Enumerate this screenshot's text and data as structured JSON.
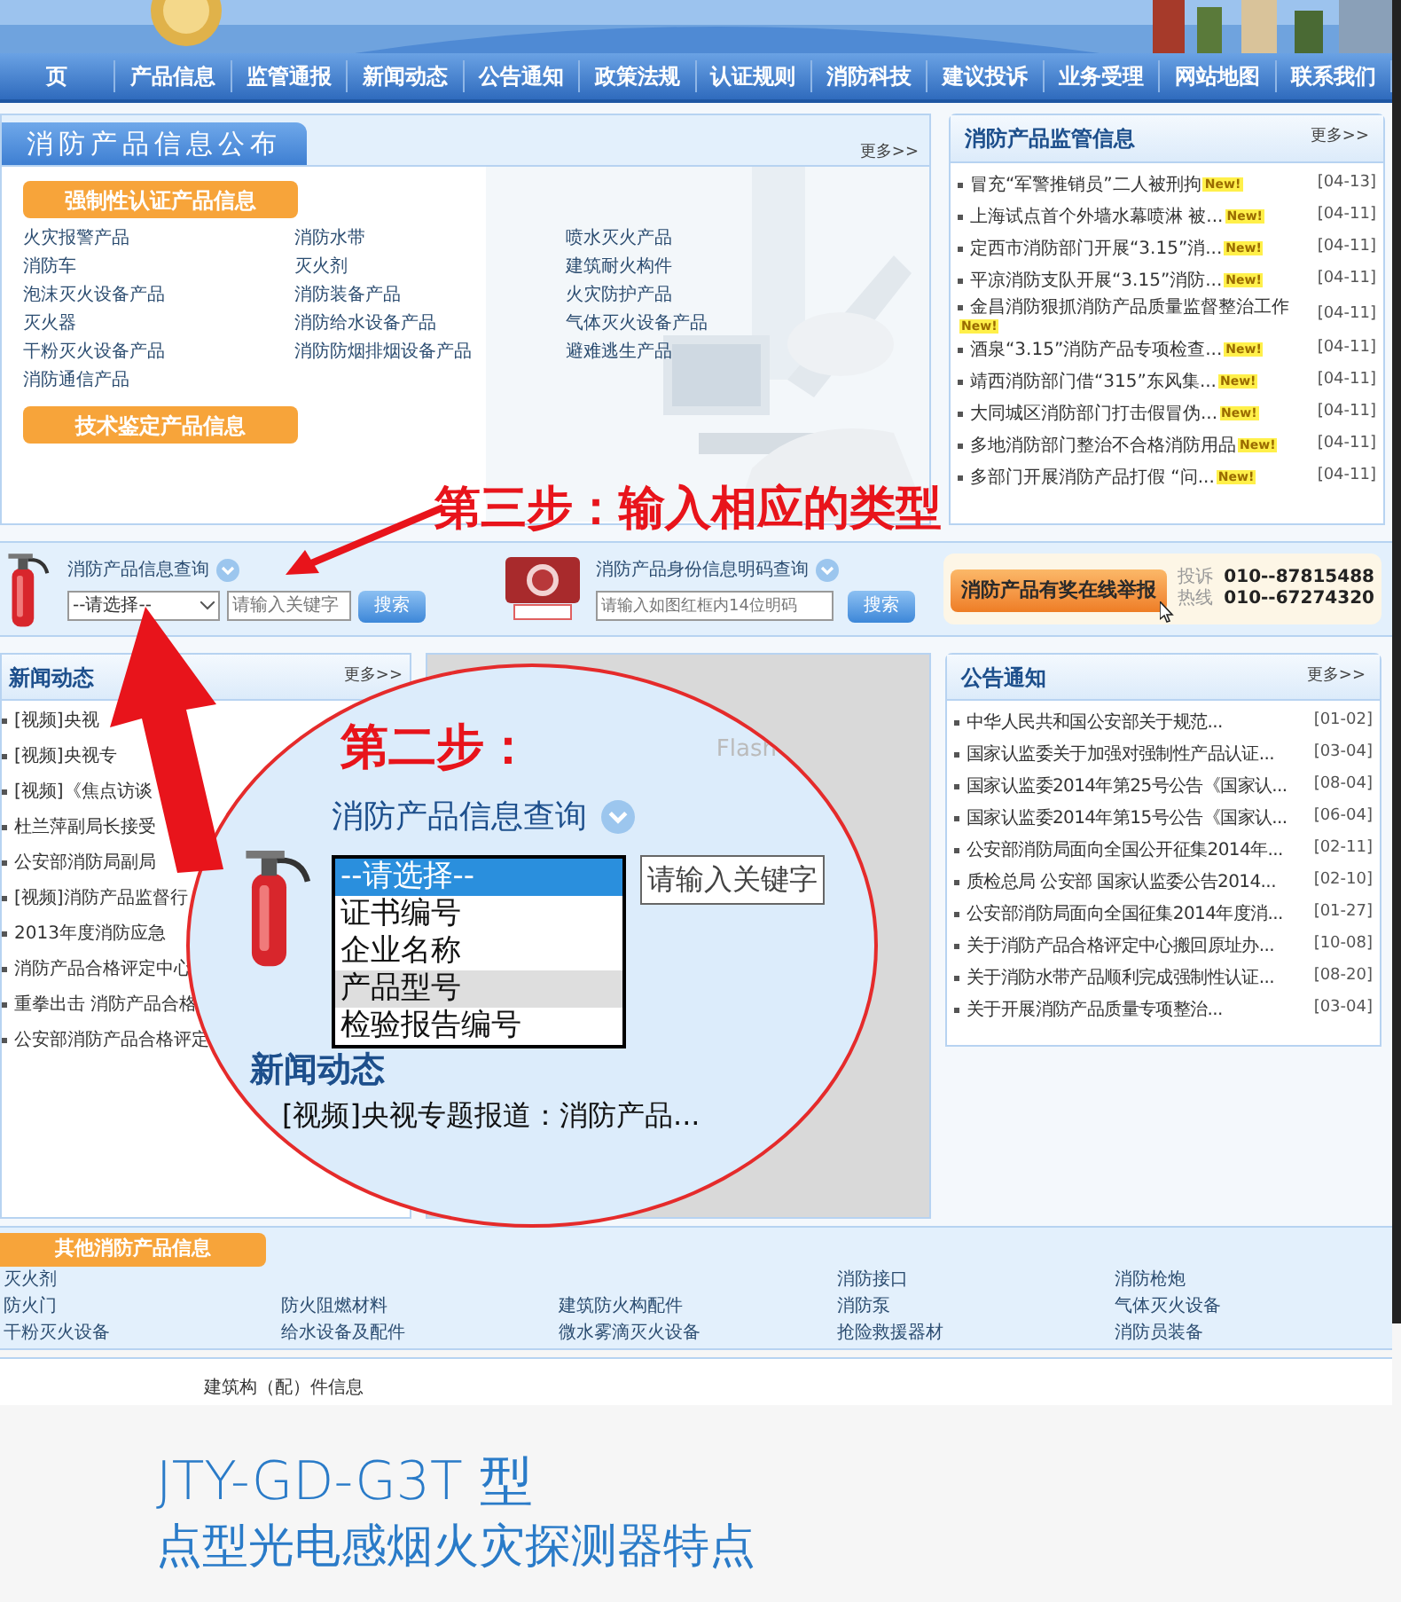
{
  "nav": [
    "页",
    "产品信息",
    "监管通报",
    "新闻动态",
    "公告通知",
    "政策法规",
    "认证规则",
    "消防科技",
    "建议投诉",
    "业务受理",
    "网站地图",
    "联系我们"
  ],
  "product_info": {
    "title": "消防产品信息公布",
    "more": "更多>>",
    "sections": [
      {
        "label": "强制性认证产品信息",
        "items": [
          "火灾报警产品",
          "消防水带",
          "喷水灭火产品",
          "消防车",
          "灭火剂",
          "建筑耐火构件",
          "泡沫灭火设备产品",
          "消防装备产品",
          "火灾防护产品",
          "灭火器",
          "消防给水设备产品",
          "气体灭火设备产品",
          "干粉灭火设备产品",
          "消防防烟排烟设备产品",
          "避难逃生产品",
          "消防通信产品"
        ]
      },
      {
        "label": "技术鉴定产品信息"
      }
    ]
  },
  "supervision": {
    "title": "消防产品监管信息",
    "more": "更多>>",
    "items": [
      {
        "text": "冒充“军警推销员”二人被刑拘",
        "badge": "New!",
        "date": "[04-13]"
      },
      {
        "text": "上海试点首个外墙水幕喷淋 被...",
        "badge": "New!",
        "date": "[04-11]"
      },
      {
        "text": "定西市消防部门开展“3.15”消...",
        "badge": "New!",
        "date": "[04-11]"
      },
      {
        "text": "平凉消防支队开展“3.15”消防...",
        "badge": "New!",
        "date": "[04-11]"
      },
      {
        "text": "金昌消防狠抓消防产品质量监督整治工作",
        "badge": "New!",
        "date": "[04-11]"
      },
      {
        "text": "酒泉“3.15”消防产品专项检查...",
        "badge": "New!",
        "date": "[04-11]"
      },
      {
        "text": "靖西消防部门借“315”东风集...",
        "badge": "New!",
        "date": "[04-11]"
      },
      {
        "text": "大同城区消防部门打击假冒伪...",
        "badge": "New!",
        "date": "[04-11]"
      },
      {
        "text": "多地消防部门整治不合格消防用品",
        "badge": "New!",
        "date": "[04-11]"
      },
      {
        "text": "多部门开展消防产品打假 “问...",
        "badge": "New!",
        "date": "[04-11]"
      }
    ]
  },
  "annotations": {
    "step3": "第三步：输入相应的类型"
  },
  "search": {
    "query": {
      "title": "消防产品信息查询",
      "select": "--请选择--",
      "placeholder": "请输入关键字",
      "button": "搜索"
    },
    "code_query": {
      "title": "消防产品身份信息明码查询",
      "placeholder": "请输入如图红框内14位明码",
      "button": "搜索"
    },
    "report": {
      "button": "消防产品有奖在线举报",
      "labels": [
        "投诉",
        "热线"
      ],
      "phones": [
        "010--87815488",
        "010--67274320"
      ]
    }
  },
  "news": {
    "title": "新闻动态",
    "more": "更多>>",
    "items": [
      "[视频]央视",
      "[视频]央视专",
      "[视频]《焦点访谈",
      "杜兰萍副局长接受",
      "公安部消防局副局",
      "[视频]消防产品监督行",
      "2013年度消防应急",
      "消防产品合格评定中心",
      "重拳出击 消防产品合格",
      "公安部消防产品合格评定"
    ]
  },
  "notices": {
    "title": "公告通知",
    "more": "更多>>",
    "items": [
      {
        "text": "中华人民共和国公安部关于规范...",
        "date": "[01-02]"
      },
      {
        "text": "国家认监委关于加强对强制性产品认证...",
        "date": "[03-04]"
      },
      {
        "text": "国家认监委2014年第25号公告《国家认...",
        "date": "[08-04]"
      },
      {
        "text": "国家认监委2014年第15号公告《国家认...",
        "date": "[06-04]"
      },
      {
        "text": "公安部消防局面向全国公开征集2014年...",
        "date": "[02-11]"
      },
      {
        "text": "质检总局 公安部 国家认监委公告2014...",
        "date": "[02-10]"
      },
      {
        "text": "公安部消防局面向全国征集2014年度消...",
        "date": "[01-27]"
      },
      {
        "text": "关于消防产品合格评定中心搬回原址办...",
        "date": "[10-08]"
      },
      {
        "text": "关于消防水带产品顺利完成强制性认证...",
        "date": "[08-20]"
      },
      {
        "text": "关于开展消防产品质量专项整治...",
        "date": "[03-04]"
      }
    ]
  },
  "magnifier": {
    "step": "第二步：",
    "flash": "Flash",
    "title": "消防产品信息查询",
    "options": [
      {
        "label": "--请选择--",
        "selected": true,
        "highlighted": false
      },
      {
        "label": "证书编号",
        "selected": false,
        "highlighted": false
      },
      {
        "label": "企业名称",
        "selected": false,
        "highlighted": false
      },
      {
        "label": "产品型号",
        "selected": false,
        "highlighted": true
      },
      {
        "label": "检验报告编号",
        "selected": false,
        "highlighted": false
      }
    ],
    "placeholder": "请输入关键字",
    "news_title": "新闻动态",
    "news_item": "[视频]央视专题报道：消防产品..."
  },
  "other_products": {
    "label": "其他消防产品信息",
    "columns": [
      [
        "灭火剂",
        "防火门",
        "干粉灭火设备"
      ],
      [
        "防火阻燃材料",
        "给水设备及配件"
      ],
      [
        "建筑防火构配件",
        "微水雾滴灭火设备"
      ],
      [
        "消防接口",
        "消防泵",
        "抢险救援器材"
      ],
      [
        "消防枪炮",
        "气体灭火设备",
        "消防员装备"
      ]
    ]
  },
  "bottom_strip": {
    "text": "建筑构（配）件信息"
  },
  "footer": {
    "model": "JTY-GD-G3T 型",
    "subtitle": "点型光电感烟火灾探测器特点"
  }
}
